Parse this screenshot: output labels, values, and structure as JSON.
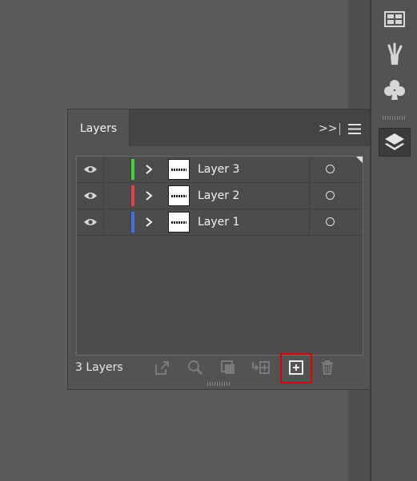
{
  "dock": {
    "buttons": [
      {
        "icon": "libraries-grid-icon"
      },
      {
        "icon": "brushes-icon"
      },
      {
        "icon": "symbols-club-icon"
      },
      {
        "icon": "layers-stack-icon",
        "active": true
      }
    ]
  },
  "panel": {
    "tab_label": "Layers",
    "collapse_label": ">>",
    "layers": [
      {
        "name": "Layer 3",
        "color": "#3fd43f"
      },
      {
        "name": "Layer 2",
        "color": "#e04444"
      },
      {
        "name": "Layer 1",
        "color": "#4472e0"
      }
    ],
    "footer": {
      "count_label": "3 Layers",
      "tools": [
        "collect-export-icon",
        "locate-object-icon",
        "clipping-mask-icon",
        "new-sublayer-icon",
        "new-layer-icon",
        "delete-icon"
      ]
    }
  },
  "colors": {
    "highlight": "#e00000",
    "panel_bg": "#535353",
    "canvas_bg": "#5b5b5b"
  }
}
